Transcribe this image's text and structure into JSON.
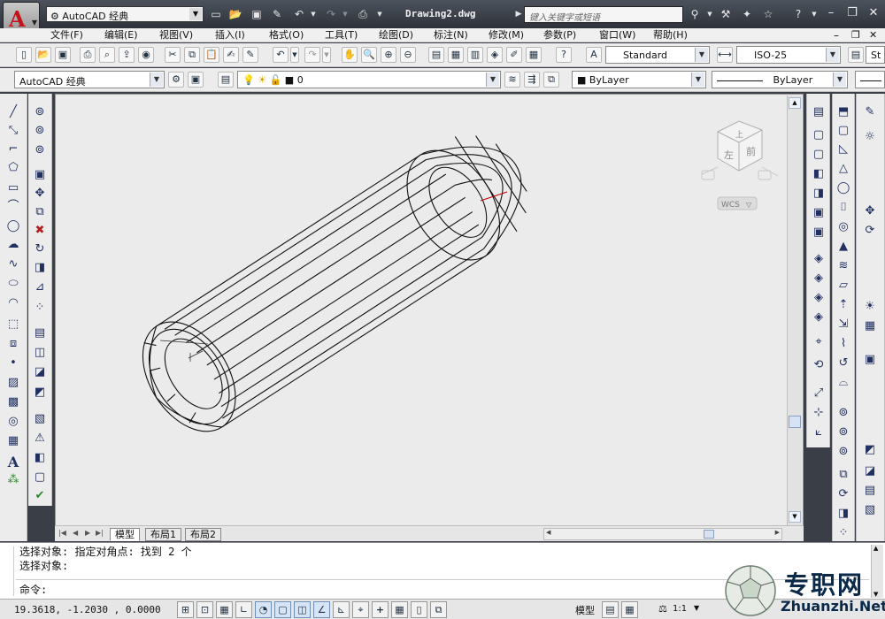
{
  "titlebar": {
    "app_logo": "A",
    "workspace": "AutoCAD 经典",
    "document_title": "Drawing2.dwg",
    "search_placeholder": "键入关键字或短语"
  },
  "menu": [
    "文件(F)",
    "编辑(E)",
    "视图(V)",
    "插入(I)",
    "格式(O)",
    "工具(T)",
    "绘图(D)",
    "标注(N)",
    "修改(M)",
    "参数(P)",
    "窗口(W)",
    "帮助(H)"
  ],
  "styles": {
    "text_style": "Standard",
    "dim_style": "ISO-25",
    "text_style_trunc": "St"
  },
  "layers": {
    "workspace": "AutoCAD 经典",
    "current_layer": "0",
    "color": "ByLayer",
    "linetype": "ByLayer"
  },
  "viewcube": {
    "top_label": "上",
    "left_label": "左",
    "right_label": "前",
    "wcs_label": "WCS"
  },
  "layout_tabs": [
    "模型",
    "布局1",
    "布局2"
  ],
  "command": {
    "history_1": "选择对象: 指定对角点: 找到 2 个",
    "history_2": "选择对象:",
    "prompt": "命令:"
  },
  "status": {
    "coordinates": "19.3618, -1.2030 , 0.0000",
    "model_label": "模型",
    "scale": "1:1"
  },
  "watermark": {
    "text_cn": "专职网",
    "text_en": "Zhuanzhi.Net"
  },
  "colors": {
    "titlebar": "#3a3f47",
    "viewport_bg": "#ebebeb",
    "logo_red": "#c0151b"
  }
}
